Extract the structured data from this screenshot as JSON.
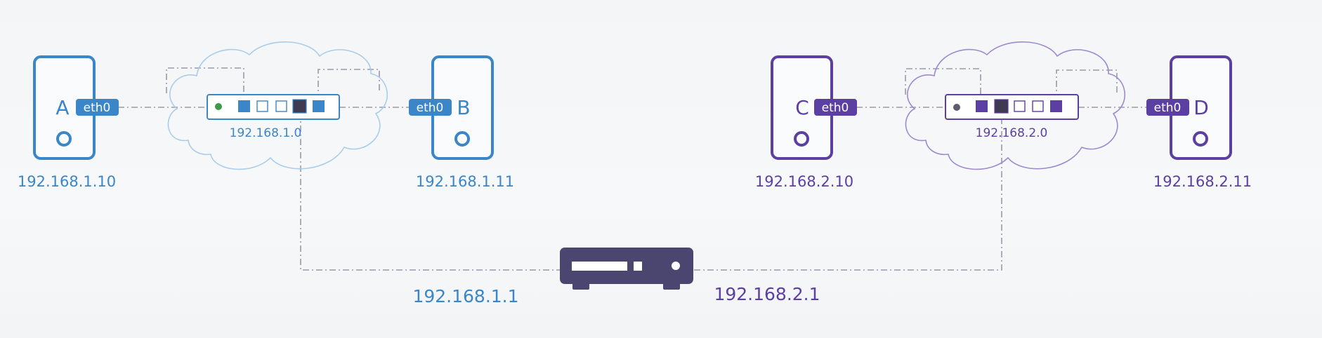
{
  "colors": {
    "blue": "#3a86c8",
    "blue_light": "#a9cdea",
    "purple": "#5b3fa3",
    "purple_light": "#9d8ad0",
    "router": "#4a4670",
    "wire": "#9a9aa8",
    "switch_dark": "#3d3a52",
    "green_dot": "#3f9a4a"
  },
  "network1": {
    "host_a": {
      "letter": "A",
      "iface": "eth0",
      "ip": "192.168.1.10"
    },
    "host_b": {
      "letter": "B",
      "iface": "eth0",
      "ip": "192.168.1.11"
    },
    "switch_label": "192.168.1.0"
  },
  "network2": {
    "host_c": {
      "letter": "C",
      "iface": "eth0",
      "ip": "192.168.2.10"
    },
    "host_d": {
      "letter": "D",
      "iface": "eth0",
      "ip": "192.168.2.11"
    },
    "switch_label": "192.168.2.0"
  },
  "router": {
    "left_ip": "192.168.1.1",
    "right_ip": "192.168.2.1"
  }
}
